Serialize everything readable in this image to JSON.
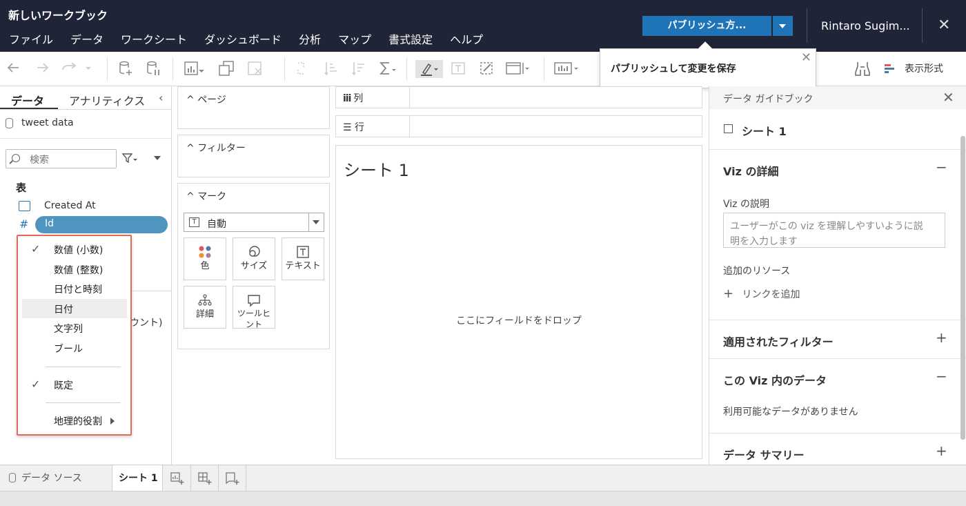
{
  "app": {
    "workbook_title": "新しいワークブック",
    "menu": [
      "ファイル",
      "データ",
      "ワークシート",
      "ダッシュボード",
      "分析",
      "マップ",
      "書式設定",
      "ヘルプ"
    ],
    "publish_label": "パブリッシュ方...",
    "user_name": "Rintaro Sugim...",
    "close_glyph": "✕"
  },
  "toolbar": {
    "show_me_label": "表示形式",
    "tooltip_text": "パブリッシュして変更を保存",
    "tooltip_close": "✕"
  },
  "data_pane": {
    "tab_data": "データ",
    "tab_analytics": "アナリティクス",
    "collapse_glyph": "‹",
    "datasource_name": "tweet data",
    "search_placeholder": "検索",
    "table_heading": "表",
    "fields": [
      {
        "name": "Created At",
        "type_icon": "calendar-time-icon"
      },
      {
        "name": "Id",
        "type_icon": "number-icon"
      }
    ],
    "partial_hidden_text": "ウント)"
  },
  "context_menu": {
    "items": [
      {
        "label": "数値 (小数)",
        "checked": true
      },
      {
        "label": "数値 (整数)",
        "checked": false
      },
      {
        "label": "日付と時刻",
        "checked": false
      },
      {
        "label": "日付",
        "checked": false,
        "highlighted": true
      },
      {
        "label": "文字列",
        "checked": false
      },
      {
        "label": "ブール",
        "checked": false
      },
      {
        "label": "既定",
        "checked": true
      },
      {
        "label": "地理的役割",
        "checked": false,
        "submenu": true
      }
    ],
    "check_glyph": "✓"
  },
  "cards": {
    "pages": "ページ",
    "filters": "フィルター",
    "marks": "マーク",
    "mark_type": "自動",
    "mark_buttons": [
      "色",
      "サイズ",
      "テキスト",
      "詳細",
      "ツールヒント"
    ]
  },
  "shelves": {
    "columns": "列",
    "rows": "行"
  },
  "canvas": {
    "sheet_title": "シート 1",
    "drop_hint": "ここにフィールドをドロップ"
  },
  "guide": {
    "title": "データ ガイドブック",
    "close_glyph": "✕",
    "sheet_name": "シート 1",
    "viz_details": "Viz の詳細",
    "viz_description_label": "Viz の説明",
    "viz_description_placeholder": "ユーザーがこの viz を理解しやすいように説明を入力します",
    "additional_resources": "追加のリソース",
    "add_link": "リンクを追加",
    "applied_filters": "適用されたフィルター",
    "data_in_viz": "この Viz 内のデータ",
    "no_data": "利用可能なデータがありません",
    "data_summary": "データ サマリー",
    "minus": "−",
    "plus": "+"
  },
  "bottom_tabs": {
    "datasource": "データ ソース",
    "sheet1": "シート 1"
  }
}
